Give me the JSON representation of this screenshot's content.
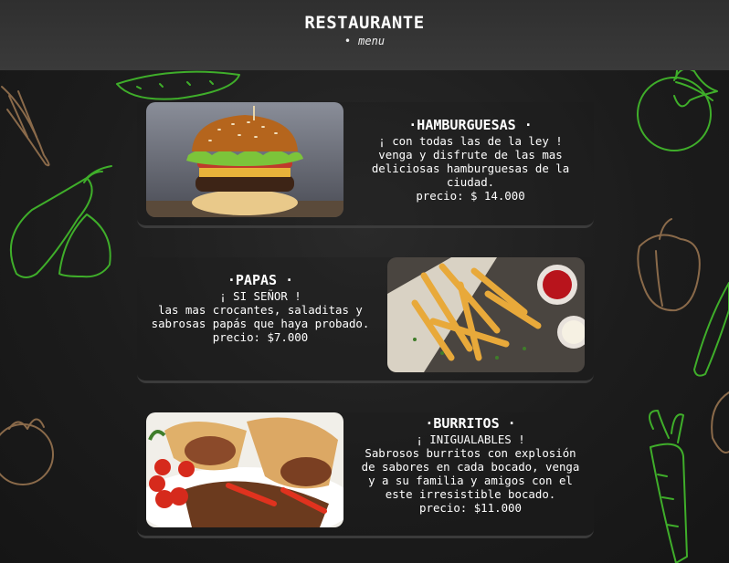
{
  "header": {
    "brand": "RESTAURANTE",
    "nav": "menu"
  },
  "menu": [
    {
      "title": "HAMBURGUESAS",
      "tagline": "¡ con todas las de la ley !",
      "description": "venga y disfrute de las mas deliciosas hamburguesas de la ciudad.",
      "price": "precio: $ 14.000"
    },
    {
      "title": "PAPAS",
      "tagline": "¡ SI SEÑOR !",
      "description": "las mas crocantes, saladitas y sabrosas papás que haya probado.",
      "price": "precio: $7.000"
    },
    {
      "title": "BURRITOS",
      "tagline": "¡ INIGUALABLES !",
      "description": "Sabrosos burritos con explosión de sabores en cada bocado, venga y a su familia y amigos con el este irresistible bocado.",
      "price": "precio: $11.000"
    }
  ],
  "colors": {
    "header": "#333333",
    "background": "#1b1b1b",
    "doodle_green": "#3fae2a",
    "doodle_brown": "#8a6a4a"
  }
}
